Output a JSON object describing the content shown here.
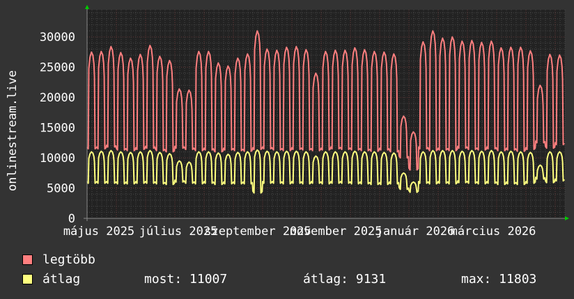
{
  "chart_data": {
    "type": "line",
    "ylabel": "onlinestream.live",
    "xlabel": "",
    "ylim": [
      0,
      34500
    ],
    "y_ticks": [
      "0",
      "5000",
      "10000",
      "15000",
      "20000",
      "25000",
      "30000"
    ],
    "x_tick_labels": [
      "május 2025",
      "július 2025",
      "szeptember 2025",
      "november 2025",
      "január 2026",
      "március 2026"
    ],
    "grid": true,
    "legend_placement": "bottom-left",
    "series": [
      {
        "name": "legtöbb",
        "color": "#ff7f7f",
        "weekly_peak": [
          27500,
          27600,
          28400,
          27400,
          26500,
          27100,
          28600,
          26800,
          26100,
          21400,
          21200,
          27600,
          27600,
          25700,
          25200,
          26500,
          27200,
          31000,
          28000,
          27800,
          28300,
          28400,
          27900,
          24000,
          27600,
          27800,
          27800,
          28200,
          27900,
          27600,
          27500,
          27200,
          16900,
          14300,
          29200,
          31000,
          29800,
          30000,
          29300,
          29400,
          29100,
          29300,
          28200,
          28300,
          28300,
          27700,
          22000,
          27100,
          27000
        ],
        "weekly_low": [
          11500,
          11500,
          11800,
          11300,
          11200,
          11400,
          11600,
          11200,
          11000,
          11600,
          11400,
          11200,
          11300,
          11000,
          11300,
          11200,
          11100,
          11400,
          11500,
          11300,
          11200,
          11400,
          11300,
          11200,
          11300,
          11500,
          11400,
          11300,
          11200,
          11100,
          11300,
          11000,
          10000,
          8000,
          11500,
          11200,
          11300,
          11200,
          11600,
          11400,
          11300,
          11500,
          11200,
          11300,
          11100,
          11400,
          12500,
          11600,
          12200
        ]
      },
      {
        "name": "átlag",
        "color": "#ffff7f",
        "weekly_peak": [
          11000,
          11100,
          11200,
          11000,
          10900,
          11000,
          11200,
          10900,
          10700,
          9500,
          9300,
          11000,
          11000,
          10800,
          10600,
          10900,
          11000,
          11300,
          11100,
          11000,
          11100,
          11100,
          11000,
          10300,
          11000,
          11000,
          11000,
          11100,
          11000,
          11000,
          10900,
          10800,
          7500,
          6000,
          11000,
          11200,
          11200,
          11200,
          11100,
          11200,
          11100,
          11200,
          11000,
          11100,
          11000,
          10900,
          8800,
          11000,
          11000
        ],
        "weekly_low": [
          5800,
          5800,
          5800,
          5700,
          5700,
          5800,
          5800,
          5700,
          5600,
          6000,
          5800,
          5700,
          5800,
          5600,
          5700,
          5700,
          5700,
          4200,
          5800,
          5800,
          5700,
          5800,
          5700,
          5800,
          5700,
          5800,
          5800,
          5700,
          5700,
          5600,
          5600,
          5700,
          4800,
          4300,
          5800,
          5700,
          5800,
          5700,
          5900,
          5800,
          5700,
          5800,
          5600,
          5700,
          5600,
          5800,
          6500,
          5900,
          6200
        ]
      }
    ]
  },
  "legend": {
    "items": [
      {
        "label": "legtöbb",
        "color": "#ff7f7f"
      },
      {
        "label": "átlag",
        "color": "#ffff7f"
      }
    ],
    "most": "most: 11007",
    "atlag": "átlag: 9131",
    "max": "max: 11803"
  }
}
